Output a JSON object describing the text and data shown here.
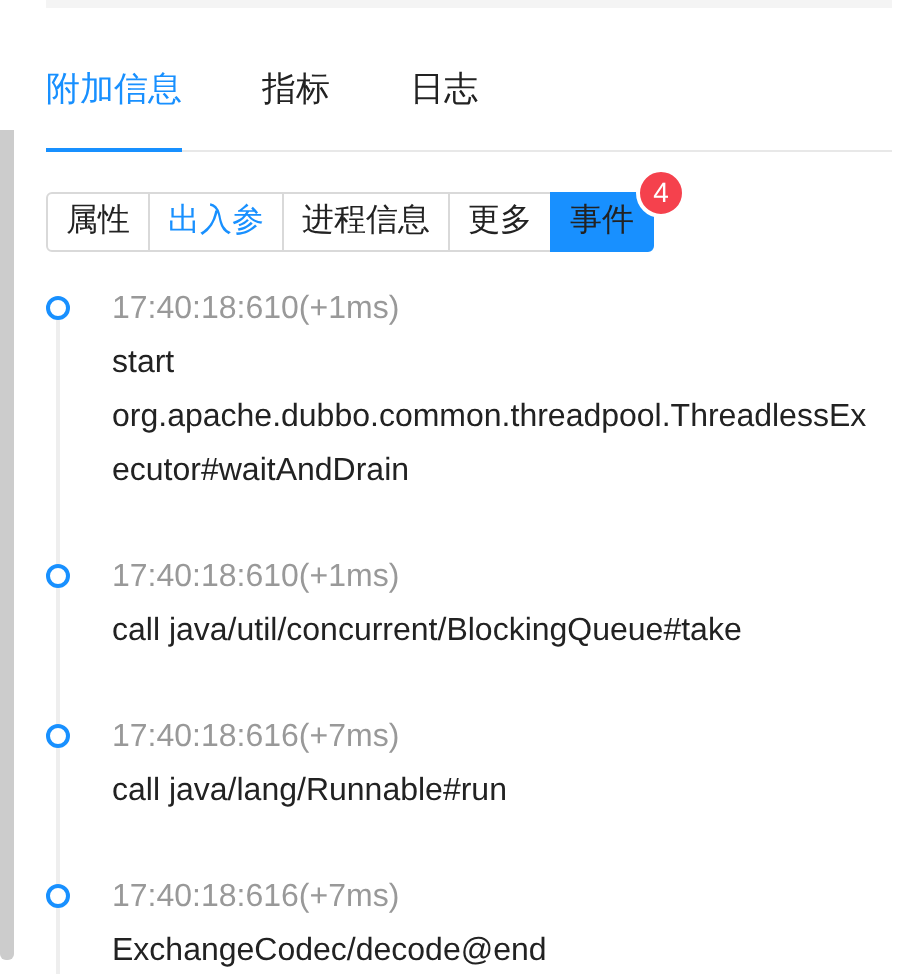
{
  "tabs": [
    {
      "label": "附加信息",
      "selected": true
    },
    {
      "label": "指标",
      "selected": false
    },
    {
      "label": "日志",
      "selected": false
    }
  ],
  "segments": [
    {
      "label": "属性",
      "selected": false,
      "highlighted": false
    },
    {
      "label": "出入参",
      "selected": false,
      "highlighted": true
    },
    {
      "label": "进程信息",
      "selected": false,
      "highlighted": false
    },
    {
      "label": "更多",
      "selected": false,
      "highlighted": false
    },
    {
      "label": "事件",
      "selected": true,
      "highlighted": false,
      "badge": "4"
    }
  ],
  "events": [
    {
      "time": "17:40:18:610(+1ms)",
      "text": "start org.apache.dubbo.common.threadpool.ThreadlessExecutor#waitAndDrain"
    },
    {
      "time": "17:40:18:610(+1ms)",
      "text": "call java/util/concurrent/BlockingQueue#take"
    },
    {
      "time": "17:40:18:616(+7ms)",
      "text": "call java/lang/Runnable#run"
    },
    {
      "time": "17:40:18:616(+7ms)",
      "text": "ExchangeCodec/decode@end"
    }
  ]
}
